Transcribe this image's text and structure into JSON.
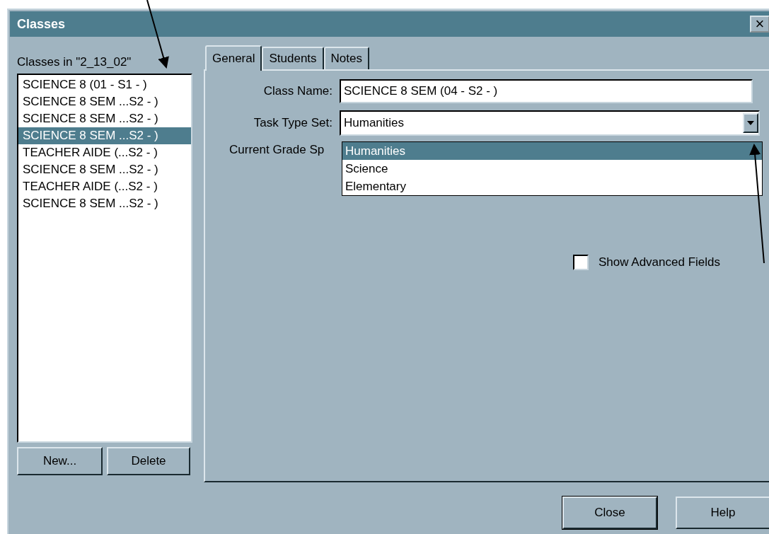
{
  "window": {
    "title": "Classes",
    "close": "×"
  },
  "class_list": {
    "label": "Classes in \"2_13_02\"",
    "items": [
      {
        "text": "SCIENCE 8 (01 - S1 - )",
        "selected": false
      },
      {
        "text": "SCIENCE 8 SEM ...S2 - )",
        "selected": false
      },
      {
        "text": "SCIENCE 8 SEM ...S2 - )",
        "selected": false
      },
      {
        "text": "SCIENCE 8 SEM ...S2 - )",
        "selected": true
      },
      {
        "text": "TEACHER AIDE (...S2 - )",
        "selected": false
      },
      {
        "text": "SCIENCE 8 SEM ...S2 - )",
        "selected": false
      },
      {
        "text": "TEACHER AIDE (...S2 - )",
        "selected": false
      },
      {
        "text": "SCIENCE 8 SEM ...S2 - )",
        "selected": false
      }
    ],
    "buttons": [
      "New...",
      "Delete"
    ]
  },
  "tabs": [
    {
      "label": "General",
      "selected": true
    },
    {
      "label": "Students",
      "selected": false
    },
    {
      "label": "Notes",
      "selected": false
    }
  ],
  "general": {
    "class_name": {
      "label": "Class Name:",
      "value": "SCIENCE 8 SEM (04 - S2 - )"
    },
    "task_type_set": {
      "label": "Task Type Set:",
      "value": "Humanities",
      "expanded": true,
      "options": [
        {
          "text": "Humanities",
          "selected": true
        },
        {
          "text": "Science",
          "selected": false
        },
        {
          "text": "Elementary",
          "selected": false
        }
      ]
    },
    "current_grade": {
      "label": "Current Grade Sp"
    },
    "show_advanced": {
      "label": "Show Advanced Fields",
      "checked": false
    }
  },
  "buttons": [
    "Close",
    "Help"
  ]
}
